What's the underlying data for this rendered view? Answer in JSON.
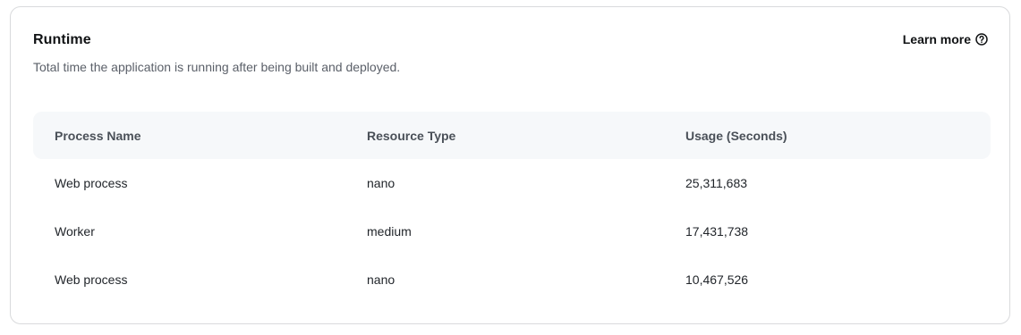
{
  "card": {
    "title": "Runtime",
    "subtitle": "Total time the application is running after being built and deployed.",
    "learn_more": "Learn more",
    "learn_more_icon": "question-circle-icon"
  },
  "table": {
    "headers": [
      "Process Name",
      "Resource Type",
      "Usage (Seconds)"
    ],
    "rows": [
      [
        "Web process",
        "nano",
        "25,311,683"
      ],
      [
        "Worker",
        "medium",
        "17,431,738"
      ],
      [
        "Web process",
        "nano",
        "10,467,526"
      ]
    ]
  }
}
